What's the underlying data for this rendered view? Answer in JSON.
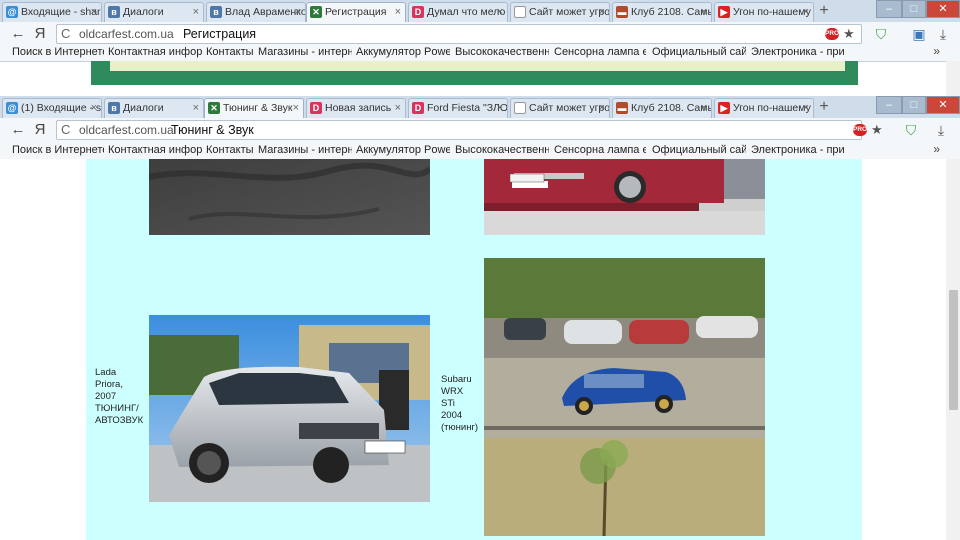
{
  "back_window": {
    "tabs": [
      {
        "label": "Входящие - shar",
        "icon": "mail-icon"
      },
      {
        "label": "Диалоги",
        "icon": "vk-icon"
      },
      {
        "label": "Влад Авраменко",
        "icon": "vk-icon"
      },
      {
        "label": "Регистрация",
        "icon": "oldcarfest-icon"
      },
      {
        "label": "Думал что мело",
        "icon": "drive2-icon"
      },
      {
        "label": "Сайт может угро",
        "icon": "page-icon"
      },
      {
        "label": "Клуб 2108. Самы",
        "icon": "club-icon"
      },
      {
        "label": "Угон по-нашему",
        "icon": "youtube-icon"
      }
    ],
    "domain": "oldcarfest.com.ua",
    "title": "Регистрация"
  },
  "front_window": {
    "tabs": [
      {
        "label": "(1) Входящие - sl",
        "icon": "mail-icon"
      },
      {
        "label": "Диалоги",
        "icon": "vk-icon"
      },
      {
        "label": "Тюнинг & Звук",
        "icon": "oldcarfest-icon"
      },
      {
        "label": "Новая запись",
        "icon": "drive2-icon"
      },
      {
        "label": "Ford Fiesta \"ЗЛО",
        "icon": "drive2-icon"
      },
      {
        "label": "Сайт может угро",
        "icon": "page-icon"
      },
      {
        "label": "Клуб 2108. Самы",
        "icon": "club-icon"
      },
      {
        "label": "Угон по-нашему",
        "icon": "youtube-icon"
      }
    ],
    "domain": "oldcarfest.com.ua",
    "title": "Тюнинг & Звук"
  },
  "nav": {
    "back": "←",
    "yandex": "Я",
    "reload": "C",
    "new_tab": "+",
    "star": "★",
    "pro": "PRO",
    "more": "»"
  },
  "window_controls": {
    "minimize": "–",
    "maximize": "□",
    "close": "✕"
  },
  "bookmarks": [
    "Поиск в Интернете",
    "Контактная информ",
    "Контакты",
    "Магазины - интерн",
    "Аккумулятор Power",
    "Высококачественн",
    "Сенсорна лампа ел",
    "Официальный сайт",
    "Электроника - прим"
  ],
  "captions": {
    "lada": "Lada\nPriora,\n2007\nТЮНИНГ/\nАВТОЗВУК",
    "subaru": "Subaru\nWRX\nSTi\n2004\n(тюнинг)"
  },
  "colors": {
    "content_bg": "#ccffff",
    "tabbar": "#cfdcea",
    "toolbar": "#f4f7fa"
  }
}
